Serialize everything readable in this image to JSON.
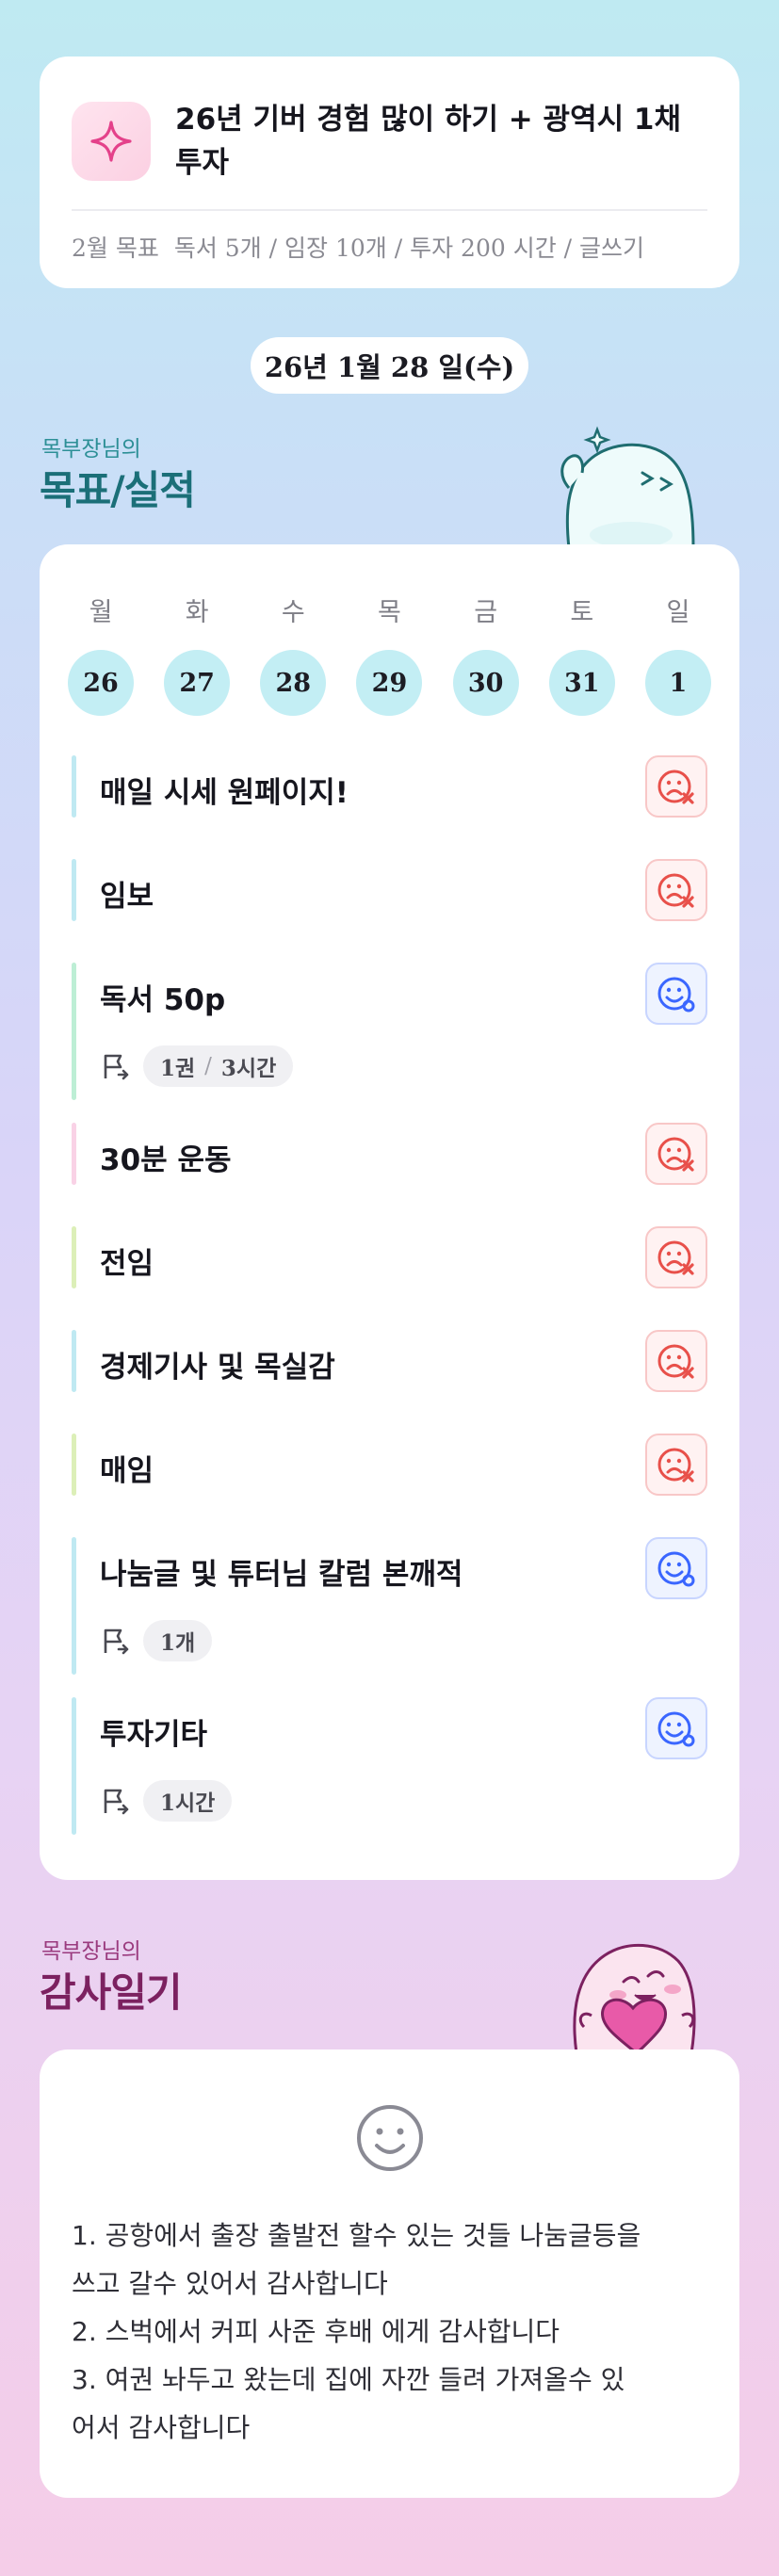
{
  "goal_card": {
    "icon": "sparkle-icon",
    "title": "26년 기버 경험 많이 하기 + 광역시 1채 투자",
    "month_label": "2월 목표",
    "month_goals": "독서 5개 / 임장 10개 / 투자 200 시간 / 글쓰기"
  },
  "date_pill": "26년 1월 28 일(수)",
  "goals_section": {
    "subtitle": "목부장님의",
    "title": "목표/실적"
  },
  "week": {
    "days": [
      "월",
      "화",
      "수",
      "목",
      "금",
      "토",
      "일"
    ],
    "dates": [
      "26",
      "27",
      "28",
      "29",
      "30",
      "31",
      "1"
    ]
  },
  "tasks": [
    {
      "name": "매일 시세 원페이지!",
      "status": "sad-face-x-icon",
      "bar_color": "#bfe9f2"
    },
    {
      "name": "임보",
      "status": "sad-face-x-icon",
      "bar_color": "#bfe9f2"
    },
    {
      "name": "독서 50p",
      "status": "happy-face-check-icon",
      "bar_color": "#bdeed5",
      "meta": [
        "1권",
        "3시간"
      ]
    },
    {
      "name": "30분 운동",
      "status": "sad-face-x-icon",
      "bar_color": "#f9d2e6"
    },
    {
      "name": "전임",
      "status": "sad-face-x-icon",
      "bar_color": "#dcefb8"
    },
    {
      "name": "경제기사 및 목실감",
      "status": "sad-face-x-icon",
      "bar_color": "#bfe9f2"
    },
    {
      "name": "매임",
      "status": "sad-face-x-icon",
      "bar_color": "#dcefb8"
    },
    {
      "name": "나눔글 및 튜터님 칼럼 본깨적",
      "status": "happy-face-check-icon",
      "bar_color": "#bfe9f2",
      "meta": [
        "1개"
      ]
    },
    {
      "name": "투자기타",
      "status": "happy-face-check-icon",
      "bar_color": "#bfe9f2",
      "meta": [
        "1시간"
      ]
    }
  ],
  "thanks_section": {
    "subtitle": "목부장님의",
    "title": "감사일기",
    "icon": "smile-icon",
    "lines": [
      "1. 공항에서 출장 출발전 할수 있는 것들 나눔글등을",
      "쓰고 갈수 있어서 감사합니다",
      "2. 스벅에서 커피 사준 후배 에게 감사합니다",
      "3. 여권 놔두고 왔는데 집에 자깐 들려 가져올수 있",
      "어서 감사합니다"
    ]
  },
  "colors": {
    "accent_teal": "#1b6f78",
    "accent_plum": "#7c2160",
    "bad_red": "#e8504a",
    "good_blue": "#3a66ff",
    "date_circle": "#c3eef4"
  }
}
